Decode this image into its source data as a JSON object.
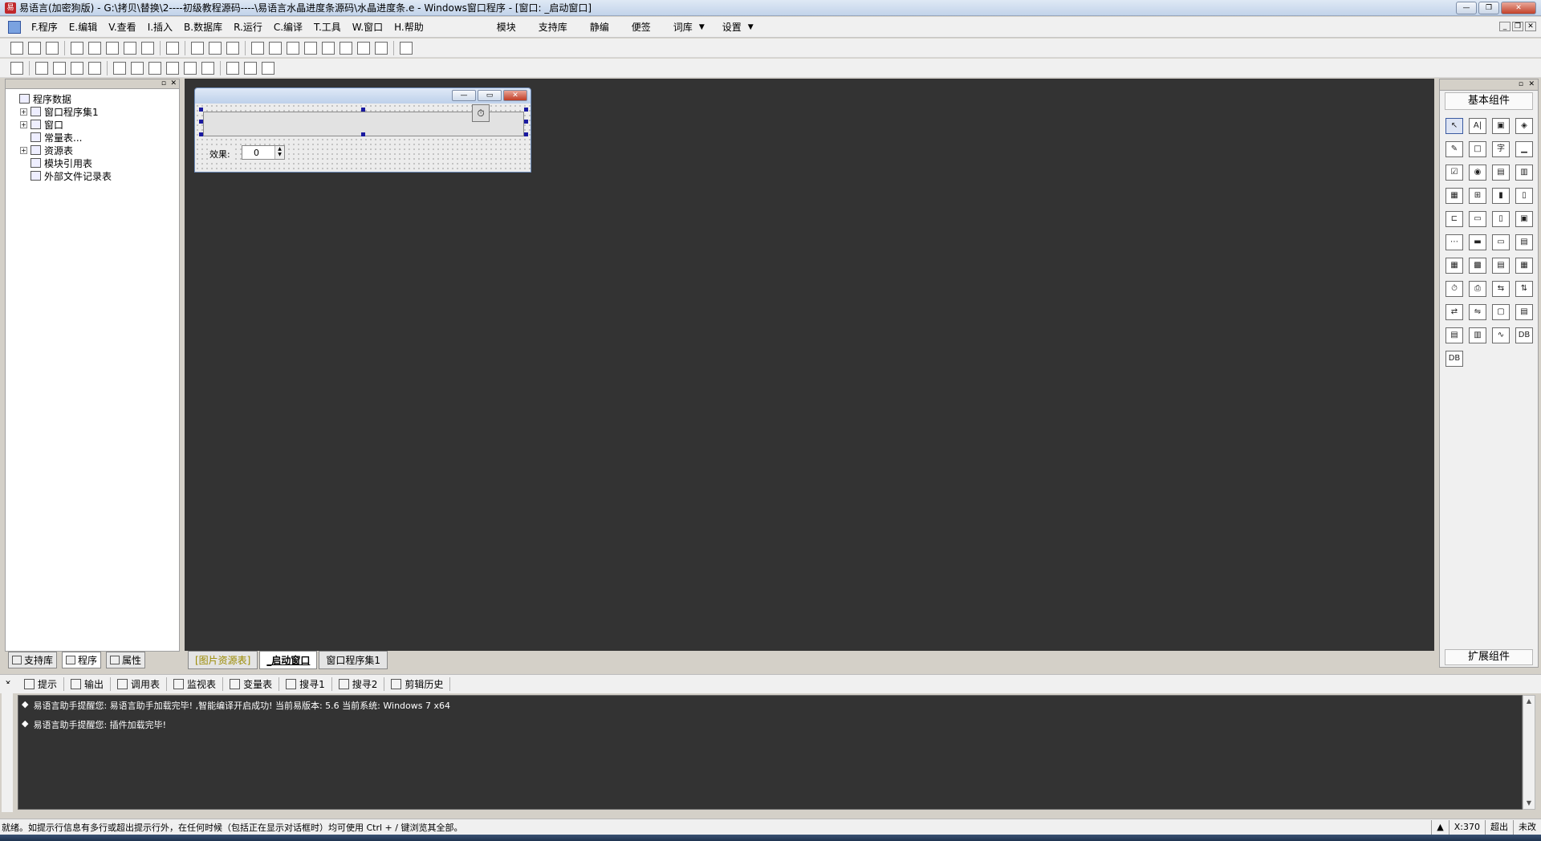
{
  "titlebar": {
    "title": "易语言(加密狗版) - G:\\拷贝\\替换\\2----初级教程源码----\\易语言水晶进度条源码\\水晶进度条.e - Windows窗口程序 - [窗口: _启动窗口]",
    "minimize": "—",
    "restore": "❐",
    "close": "✕"
  },
  "menu": {
    "items": [
      "F.程序",
      "E.编辑",
      "V.查看",
      "I.插入",
      "B.数据库",
      "R.运行",
      "C.编译",
      "T.工具",
      "W.窗口",
      "H.帮助"
    ],
    "extra": [
      "模块",
      "支持库",
      "静编",
      "便签",
      "词库",
      "设置"
    ]
  },
  "toolbar1": {
    "icons": [
      "new-file-icon",
      "open-file-icon",
      "save-icon",
      "sep",
      "cut-icon",
      "copy-icon",
      "paste-icon",
      "redo-icon",
      "undo-icon",
      "sep",
      "find-icon",
      "sep",
      "layout1-icon",
      "layout2-icon",
      "layout3-icon",
      "sep",
      "run-icon",
      "stop-icon",
      "step-icon",
      "step-into-icon",
      "step-out-icon",
      "run-to-icon",
      "breakpoint-icon",
      "hand-icon",
      "sep",
      "binoculars-icon"
    ]
  },
  "toolbar2": {
    "icons": [
      "grid-icon",
      "sep",
      "align-left-icon",
      "align-center-icon",
      "align-top-icon",
      "align-bottom-icon",
      "sep",
      "same-width-icon",
      "same-height-icon",
      "space-h-icon",
      "space-v-icon",
      "center-h-icon",
      "center-v-icon",
      "sep",
      "tab-order-icon",
      "lock-icon",
      "zoom-icon"
    ]
  },
  "leftpanel": {
    "tree": [
      {
        "label": "程序数据",
        "level": 0,
        "expander": ""
      },
      {
        "label": "窗口程序集1",
        "level": 1,
        "expander": "+"
      },
      {
        "label": "窗口",
        "level": 1,
        "expander": "+"
      },
      {
        "label": "常量表...",
        "level": 1,
        "expander": ""
      },
      {
        "label": "资源表",
        "level": 1,
        "expander": "+"
      },
      {
        "label": "模块引用表",
        "level": 1,
        "expander": ""
      },
      {
        "label": "外部文件记录表",
        "level": 1,
        "expander": ""
      }
    ],
    "tabs": [
      "支持库",
      "程序",
      "属性"
    ]
  },
  "form": {
    "effect_label": "效果:",
    "spin_value": "0",
    "timer_glyph": "⏱"
  },
  "workspace_tabs": [
    "[图片资源表]",
    "_启动窗口",
    "窗口程序集1"
  ],
  "rightpanel": {
    "title": "基本组件",
    "footer": "扩展组件",
    "components": [
      "↖",
      "A|",
      "▣",
      "◈",
      "✎",
      "□",
      "字",
      "▁",
      "☑",
      "◉",
      "▤",
      "▥",
      "▦",
      "⊞",
      "▮",
      "▯",
      "⊏",
      "▭",
      "▯",
      "▣",
      "⋯",
      "▬",
      "▭",
      "▤",
      "▦",
      "▩",
      "▤",
      "▦",
      "⏱",
      "⎙",
      "⇆",
      "⇅",
      "⇄",
      "⇋",
      "▢",
      "▤",
      "▤",
      "▥",
      "∿",
      "DB",
      "DB"
    ]
  },
  "bottomtabs": [
    "提示",
    "输出",
    "调用表",
    "监视表",
    "变量表",
    "搜寻1",
    "搜寻2",
    "剪辑历史"
  ],
  "output": {
    "lines": [
      "易语言助手提醒您: 易语言助手加载完毕! ,智能编译开启成功! 当前易版本: 5.6 当前系统: Windows 7 x64",
      "易语言助手提醒您: 插件加载完毕!"
    ]
  },
  "statusbar": {
    "message": "就绪。如提示行信息有多行或超出提示行外，在任何时候（包括正在显示对话框时）均可使用 Ctrl + / 键浏览其全部。",
    "coord": "X:370",
    "mode": "超出",
    "state": "未改"
  }
}
